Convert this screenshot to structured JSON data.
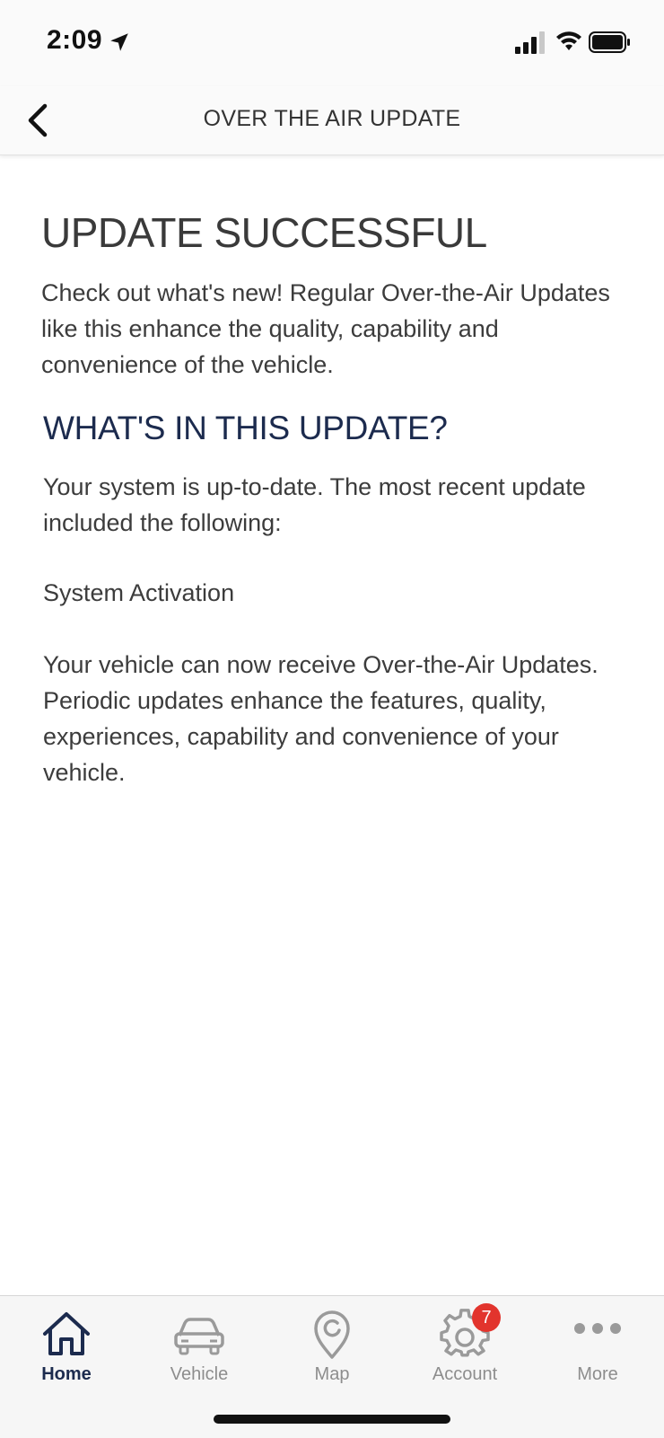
{
  "status_bar": {
    "time": "2:09"
  },
  "nav": {
    "title": "OVER THE AIR UPDATE",
    "back_icon": "chevron-left-icon"
  },
  "content": {
    "heading": "UPDATE SUCCESSFUL",
    "intro": "Check out what's new! Regular Over-the-Air Updates like this enhance the quality, capability and convenience of the vehicle.",
    "section_heading": "WHAT'S IN THIS UPDATE?",
    "status_text": "Your system is up-to-date. The most recent update included the following:",
    "feature_title": "System Activation",
    "feature_description": "Your vehicle can now receive Over-the-Air Updates. Periodic updates enhance the features, quality, experiences, capability and convenience of your vehicle."
  },
  "tabs": [
    {
      "label": "Home",
      "icon": "home-icon",
      "active": true
    },
    {
      "label": "Vehicle",
      "icon": "car-icon",
      "active": false
    },
    {
      "label": "Map",
      "icon": "map-pin-icon",
      "active": false
    },
    {
      "label": "Account",
      "icon": "gear-icon",
      "active": false,
      "badge": "7"
    },
    {
      "label": "More",
      "icon": "more-dots-icon",
      "active": false
    }
  ],
  "colors": {
    "accent": "#1c2b4e",
    "badge": "#e2342d",
    "inactive": "#8d8d8d"
  }
}
